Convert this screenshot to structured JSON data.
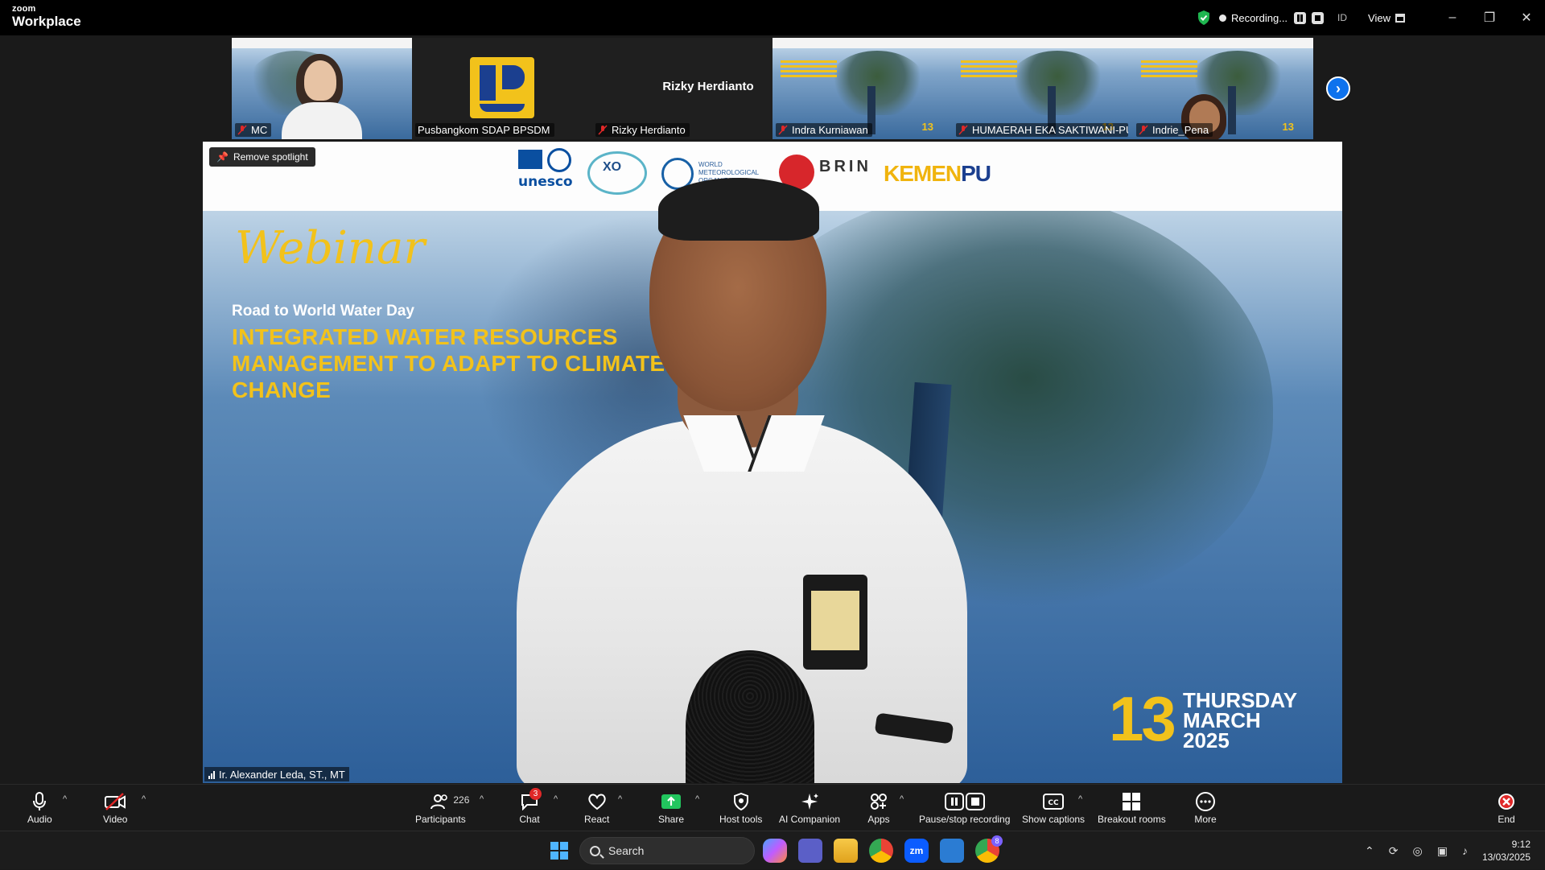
{
  "app": {
    "logo_top": "zoom",
    "logo_bottom": "Workplace"
  },
  "titlebar": {
    "recording_label": "Recording...",
    "meeting_id": "ID",
    "view_label": "View"
  },
  "gallery": {
    "tiles": [
      {
        "name": "MC",
        "muted": true
      },
      {
        "name": "Pusbangkom SDAP BPSDM",
        "muted": false
      },
      {
        "name": "Rizky Herdianto",
        "display_name": "Rizky Herdianto",
        "muted": true
      },
      {
        "name": "Indra Kurniawan",
        "muted": true,
        "slide_number": "13"
      },
      {
        "name": "HUMAERAH EKA SAKTIWANI-PU...",
        "muted": true,
        "slide_number": "13"
      },
      {
        "name": "Indrie_Pena",
        "muted": true,
        "slide_number": "13"
      }
    ]
  },
  "stage": {
    "remove_spotlight_label": "Remove spotlight",
    "speaker_name": "Ir. Alexander Leda, ST., MT",
    "slide": {
      "logos": {
        "unesco": "unesco",
        "wmo": "WORLD METEOROLOGICAL ORGANIZATION",
        "anniversary": "XO",
        "brin": "BRIN",
        "kemen_a": "KEMEN",
        "kemen_b": "PU"
      },
      "script_title": "Webinar",
      "subtitle": "Road to World Water Day",
      "headline": "INTEGRATED WATER RESOURCES MANAGEMENT TO ADAPT TO CLIMATE CHANGE",
      "date_number": "13",
      "date_day": "THURSDAY",
      "date_month": "MARCH",
      "date_year": "2025"
    }
  },
  "toolbar": {
    "audio": "Audio",
    "video": "Video",
    "participants": "Participants",
    "participant_count": "226",
    "chat": "Chat",
    "chat_badge": "3",
    "react": "React",
    "share": "Share",
    "host_tools": "Host tools",
    "ai_companion": "AI Companion",
    "apps": "Apps",
    "pause_stop": "Pause/stop recording",
    "captions": "Show captions",
    "breakout": "Breakout rooms",
    "more": "More",
    "end": "End"
  },
  "taskbar": {
    "search_placeholder": "Search",
    "time": "9:12",
    "date": "13/03/2025",
    "chrome_badge": "8"
  },
  "colors": {
    "accent_blue": "#0e72ed",
    "slide_yellow": "#f2c21b",
    "share_green": "#22c55e",
    "end_red": "#e02828"
  }
}
